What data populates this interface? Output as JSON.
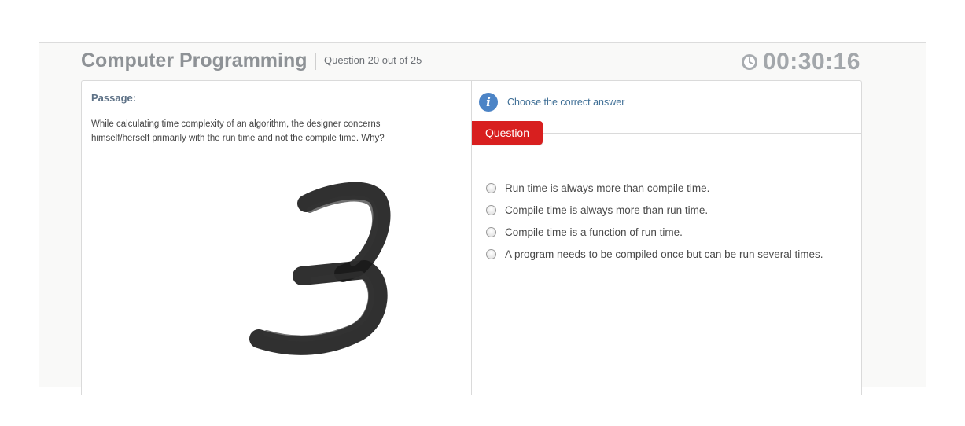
{
  "header": {
    "title": "Computer Programming",
    "question_counter": "Question 20 out of 25",
    "timer": "00:30:16"
  },
  "passage": {
    "label": "Passage:",
    "text": "While calculating time complexity of an algorithm, the designer concerns himself/herself primarily with the run time and not the compile time. Why?",
    "handwritten_mark": "3"
  },
  "question_panel": {
    "instruction": "Choose the correct answer",
    "tab_label": "Question",
    "options": [
      {
        "label": "Run time is always more than compile time.",
        "selected": false
      },
      {
        "label": "Compile time is always more than run time.",
        "selected": false
      },
      {
        "label": "Compile time is a function of run time.",
        "selected": false
      },
      {
        "label": "A program needs to be compiled once but can be run several times.",
        "selected": false
      }
    ]
  },
  "icons": {
    "timer": "clock-icon",
    "instruction": "info-icon"
  },
  "colors": {
    "accent_red": "#d81f1f",
    "info_blue": "#4c84c6",
    "title_gray": "#8e9296"
  }
}
